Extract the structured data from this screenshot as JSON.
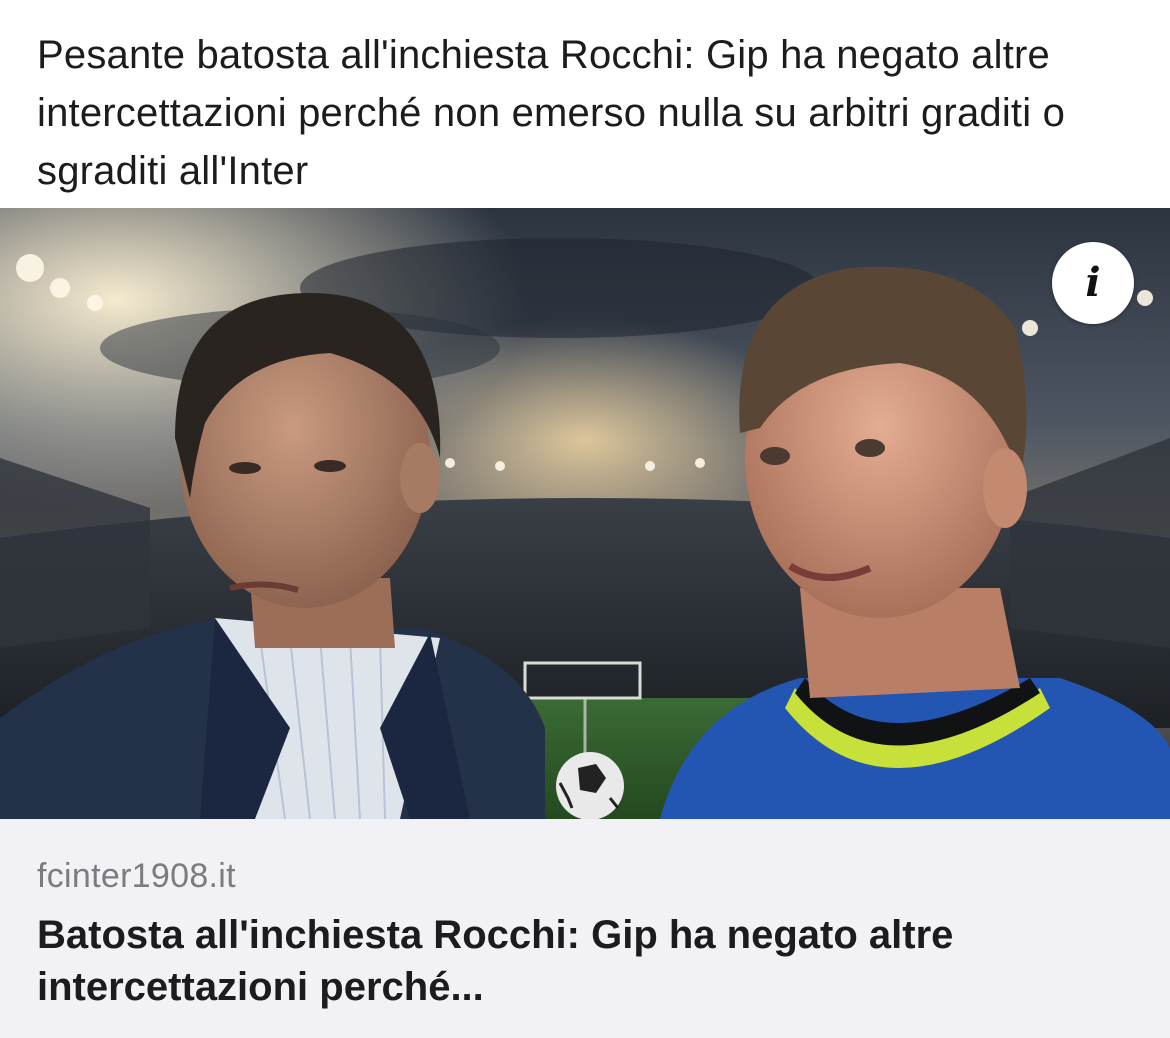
{
  "post": {
    "text": "Pesante batosta all'inchiesta Rocchi: Gip ha negato altre intercettazioni perché non emerso nulla su arbitri graditi o sgraditi all'Inter"
  },
  "link_preview": {
    "image_description_icon": "info-icon",
    "info_glyph": "i",
    "domain": "fcinter1908.it",
    "title": "Batosta all'inchiesta Rocchi: Gip ha negato altre intercettazioni perché..."
  },
  "colors": {
    "background": "#ffffff",
    "card_footer": "#f2f2f6",
    "domain_text": "#7b7b80",
    "title_text": "#1c1c1e"
  }
}
